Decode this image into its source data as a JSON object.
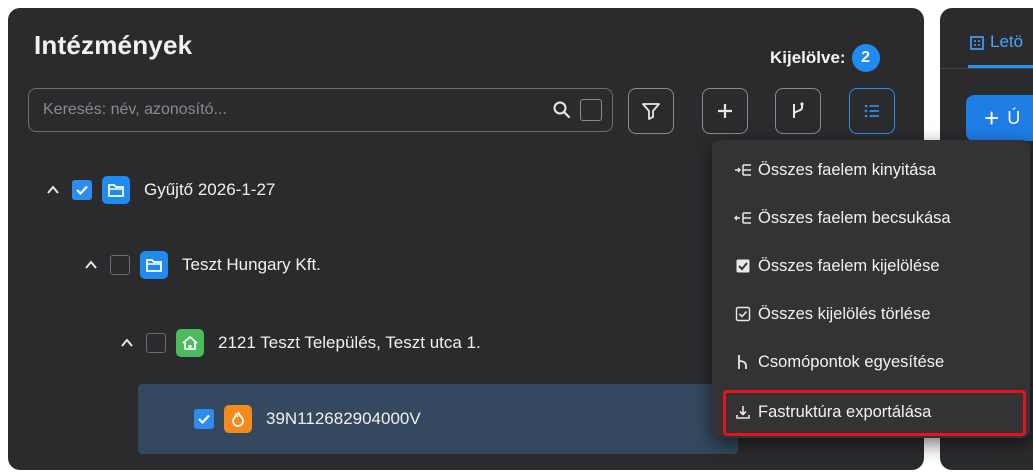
{
  "panel": {
    "title": "Intézmények",
    "selected_label": "Kijelölve:",
    "selected_count": "2"
  },
  "search": {
    "placeholder": "Keresés: név, azonosító..."
  },
  "toolbar": {
    "buttons": [
      {
        "name": "filter",
        "icon": "funnel-icon"
      },
      {
        "name": "add",
        "icon": "plus-icon"
      },
      {
        "name": "branch",
        "icon": "branch-icon"
      },
      {
        "name": "list-menu",
        "icon": "list-icon",
        "active": true
      }
    ]
  },
  "tree": [
    {
      "label": "Gyűjtő 2026-1-27",
      "checked": true,
      "icon": "folder-icon",
      "icon_color": "#1f8af0"
    },
    {
      "label": "Teszt Hungary Kft.",
      "checked": false,
      "icon": "folder-icon",
      "icon_color": "#1f8af0"
    },
    {
      "label": "2121 Teszt Település, Teszt utca 1.",
      "checked": false,
      "icon": "home-icon",
      "icon_color": "#4cbb5c"
    },
    {
      "label": "39N112682904000V",
      "checked": true,
      "icon": "flame-icon",
      "icon_color": "#f28a1c"
    }
  ],
  "right_panel": {
    "tab_label": "Letö",
    "new_button_label": "Ú"
  },
  "context_menu": {
    "items": [
      {
        "label": "Összes faelem kinyitása",
        "icon": "expand-tree-icon"
      },
      {
        "label": "Összes faelem becsukása",
        "icon": "collapse-tree-icon"
      },
      {
        "label": "Összes faelem kijelölése",
        "icon": "checkbox-checked-icon"
      },
      {
        "label": "Összes kijelölés törlése",
        "icon": "checkbox-outline-icon"
      },
      {
        "label": "Csomópontok egyesítése",
        "icon": "merge-icon"
      },
      {
        "label": "Fastruktúra exportálása",
        "icon": "download-icon",
        "highlighted": true
      }
    ]
  },
  "colors": {
    "accent": "#1f8af0",
    "highlight": "#e3141b",
    "panel_bg": "#2b2b2e"
  }
}
